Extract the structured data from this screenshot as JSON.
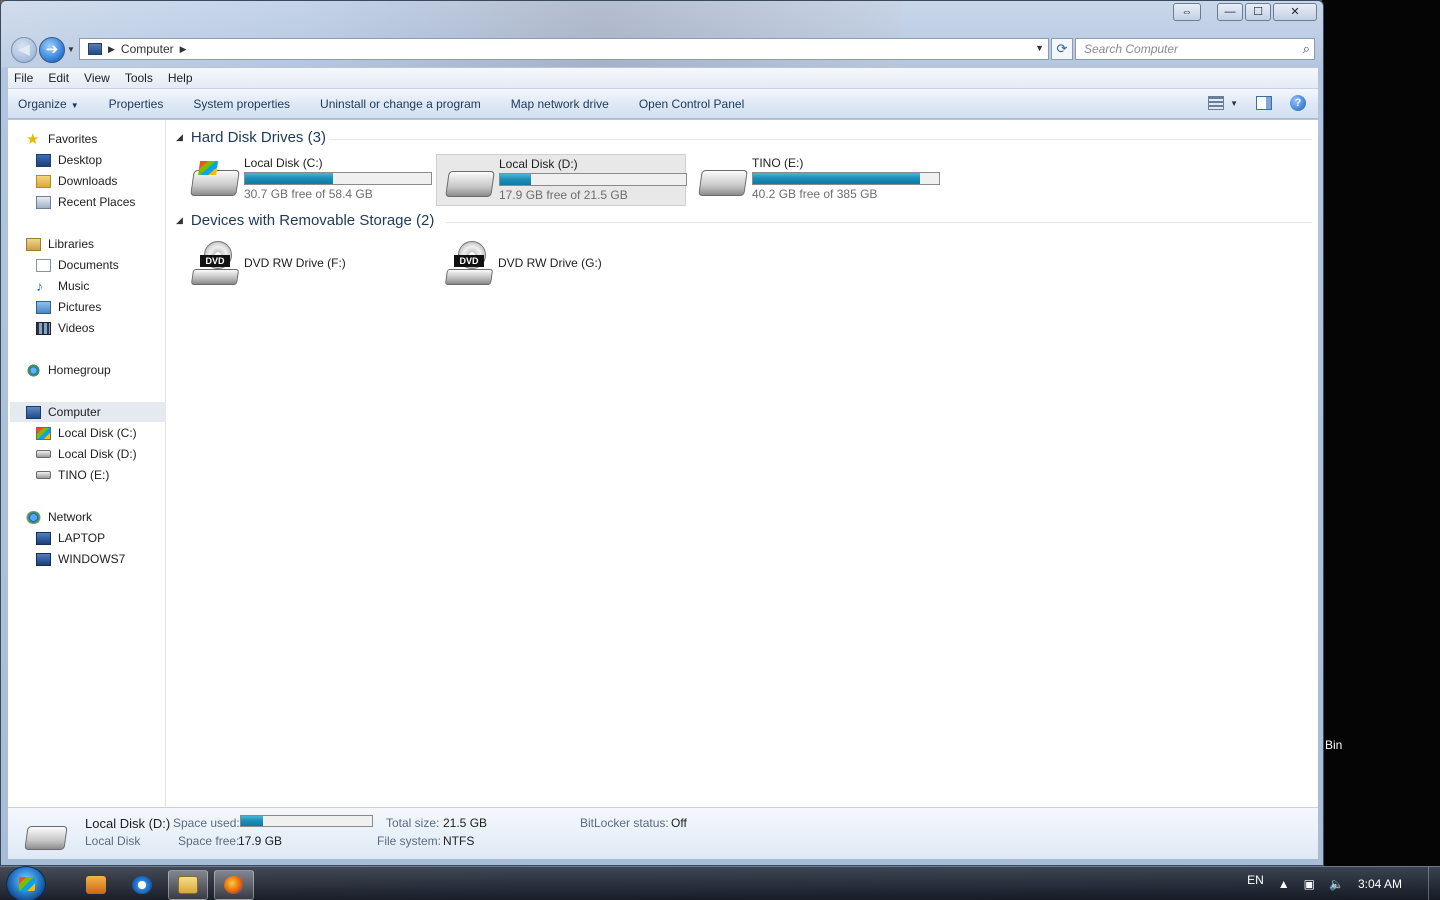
{
  "window": {
    "controls": [
      "⇔",
      "—",
      "☐",
      "✕"
    ]
  },
  "address": {
    "crumbs": [
      "Computer"
    ],
    "search_placeholder": "Search Computer"
  },
  "menu": [
    "File",
    "Edit",
    "View",
    "Tools",
    "Help"
  ],
  "commands": {
    "organize": "Organize",
    "properties": "Properties",
    "system_properties": "System properties",
    "uninstall": "Uninstall or change a program",
    "map_drive": "Map network drive",
    "control_panel": "Open Control Panel"
  },
  "nav_pane": {
    "favorites": {
      "label": "Favorites",
      "items": [
        "Desktop",
        "Downloads",
        "Recent Places"
      ]
    },
    "libraries": {
      "label": "Libraries",
      "items": [
        "Documents",
        "Music",
        "Pictures",
        "Videos"
      ]
    },
    "homegroup": "Homegroup",
    "computer": {
      "label": "Computer",
      "items": [
        "Local Disk (C:)",
        "Local Disk (D:)",
        "TINO (E:)"
      ]
    },
    "network": {
      "label": "Network",
      "items": [
        "LAPTOP",
        "WINDOWS7"
      ]
    }
  },
  "groups": {
    "hard_disks": {
      "title": "Hard Disk Drives (3)",
      "drives": [
        {
          "name": "Local Disk (C:)",
          "free_text": "30.7 GB free of 58.4 GB",
          "used_fraction": 0.474,
          "selected": false
        },
        {
          "name": "Local Disk (D:)",
          "free_text": "17.9 GB free of 21.5 GB",
          "used_fraction": 0.167,
          "selected": true
        },
        {
          "name": "TINO (E:)",
          "free_text": "40.2 GB free of 385 GB",
          "used_fraction": 0.896,
          "selected": false
        }
      ]
    },
    "removable": {
      "title": "Devices with Removable Storage (2)",
      "devices": [
        {
          "name": "DVD RW Drive (F:)",
          "badge": "DVD"
        },
        {
          "name": "DVD RW Drive (G:)",
          "badge": "DVD"
        }
      ]
    }
  },
  "details": {
    "title": "Local Disk (D:)",
    "subtitle": "Local Disk",
    "space_used_label": "Space used:",
    "space_used_fraction": 0.167,
    "space_free_label": "Space free:",
    "space_free_value": "17.9 GB",
    "total_size_label": "Total size:",
    "total_size_value": "21.5 GB",
    "file_system_label": "File system:",
    "file_system_value": "NTFS",
    "bitlocker_label": "BitLocker status:",
    "bitlocker_value": "Off"
  },
  "desktop": {
    "bin_label": "Bin"
  },
  "taskbar": {
    "language": "EN",
    "time": "3:04 AM"
  },
  "colors": {
    "accent": "#1e395b",
    "progress": "#1a8db8",
    "selection": "#e5eaf1"
  }
}
